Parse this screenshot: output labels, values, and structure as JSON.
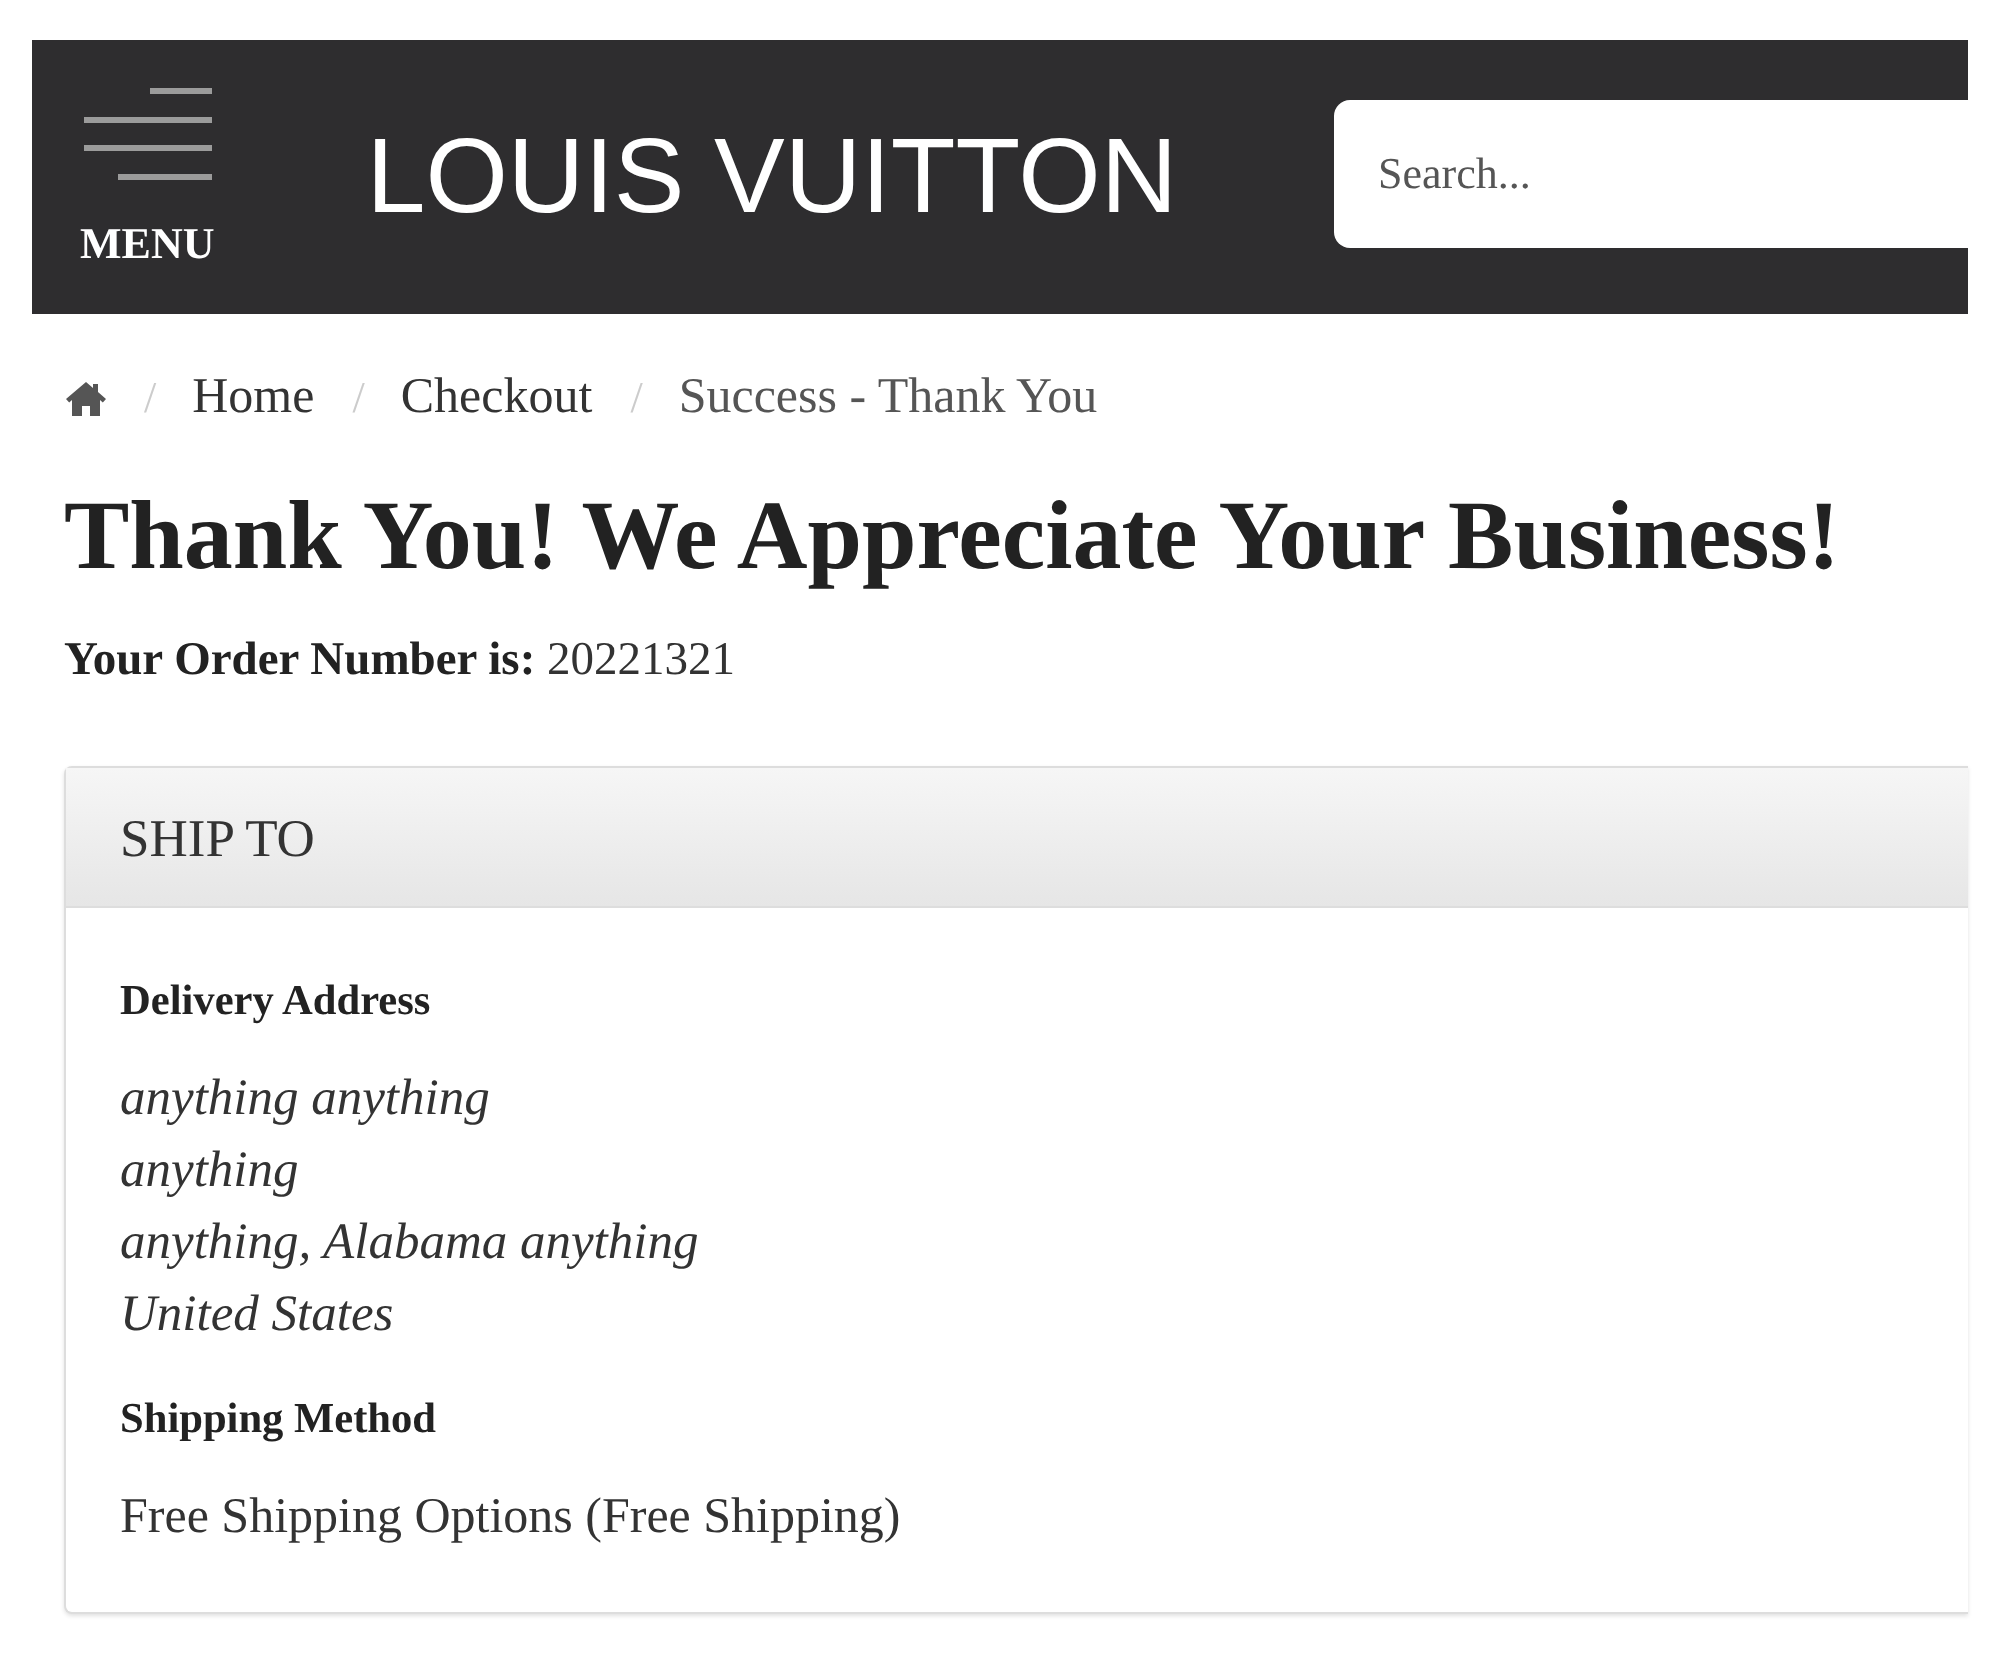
{
  "header": {
    "menu_label": "MENU",
    "logo": "LOUIS VUITTON",
    "search": {
      "placeholder": "Search..."
    }
  },
  "breadcrumb": [
    {
      "separator": "/",
      "label": "Home",
      "current": false
    },
    {
      "separator": "/",
      "label": "Checkout",
      "current": false
    },
    {
      "separator": "/",
      "label": "Success - Thank You",
      "current": true
    }
  ],
  "heading": "Thank You! We Appreciate Your Business!",
  "order_number": "**Your Order Number is:** 20221321",
  "ship_to": {
    "title": "SHIP TO",
    "delivery_address": {
      "label": "Delivery Address",
      "lines": [
        "anything anything",
        "anything",
        "anything, Alabama anything",
        "United States"
      ]
    },
    "shipping_method": {
      "label": "Shipping Method",
      "value": "Free Shipping Options (Free Shipping)"
    }
  }
}
